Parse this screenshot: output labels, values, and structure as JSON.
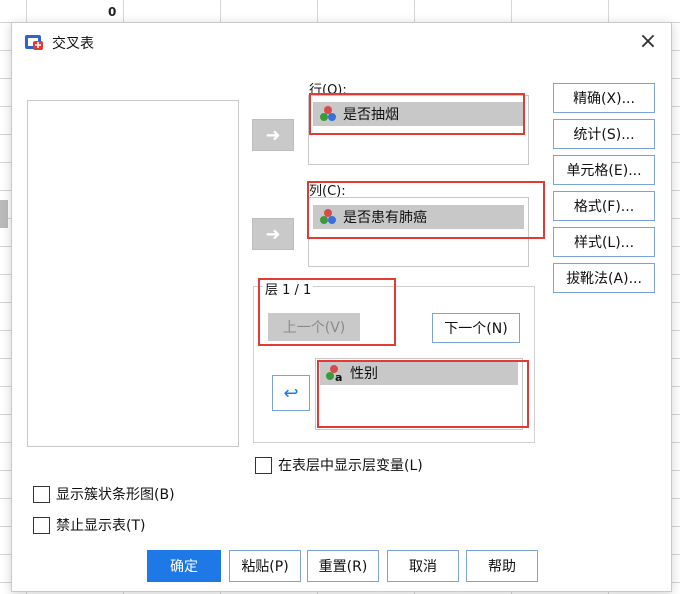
{
  "background": {
    "cell_value": "0"
  },
  "dialog": {
    "title": "交叉表",
    "close_label": "×",
    "row": {
      "label": "行(O):",
      "variable": "是否抽烟"
    },
    "column": {
      "label": "列(C):",
      "variable": "是否患有肺癌"
    },
    "layer": {
      "label": "层 1 / 1",
      "prev_label": "上一个(V)",
      "next_label": "下一个(N)",
      "variable": "性别"
    },
    "right_buttons": [
      "精确(X)...",
      "统计(S)...",
      "单元格(E)...",
      "格式(F)...",
      "样式(L)...",
      "拔靴法(A)..."
    ],
    "show_layer_checkbox": "在表层中显示层变量(L)",
    "checkboxes": [
      "显示簇状条形图(B)",
      "禁止显示表(T)"
    ],
    "bottom_buttons": [
      "确定",
      "粘贴(P)",
      "重置(R)",
      "取消",
      "帮助"
    ],
    "colors": {
      "primary": "#1e78e6",
      "highlight": "#e53935",
      "item_bg": "#c8c8c8"
    }
  }
}
